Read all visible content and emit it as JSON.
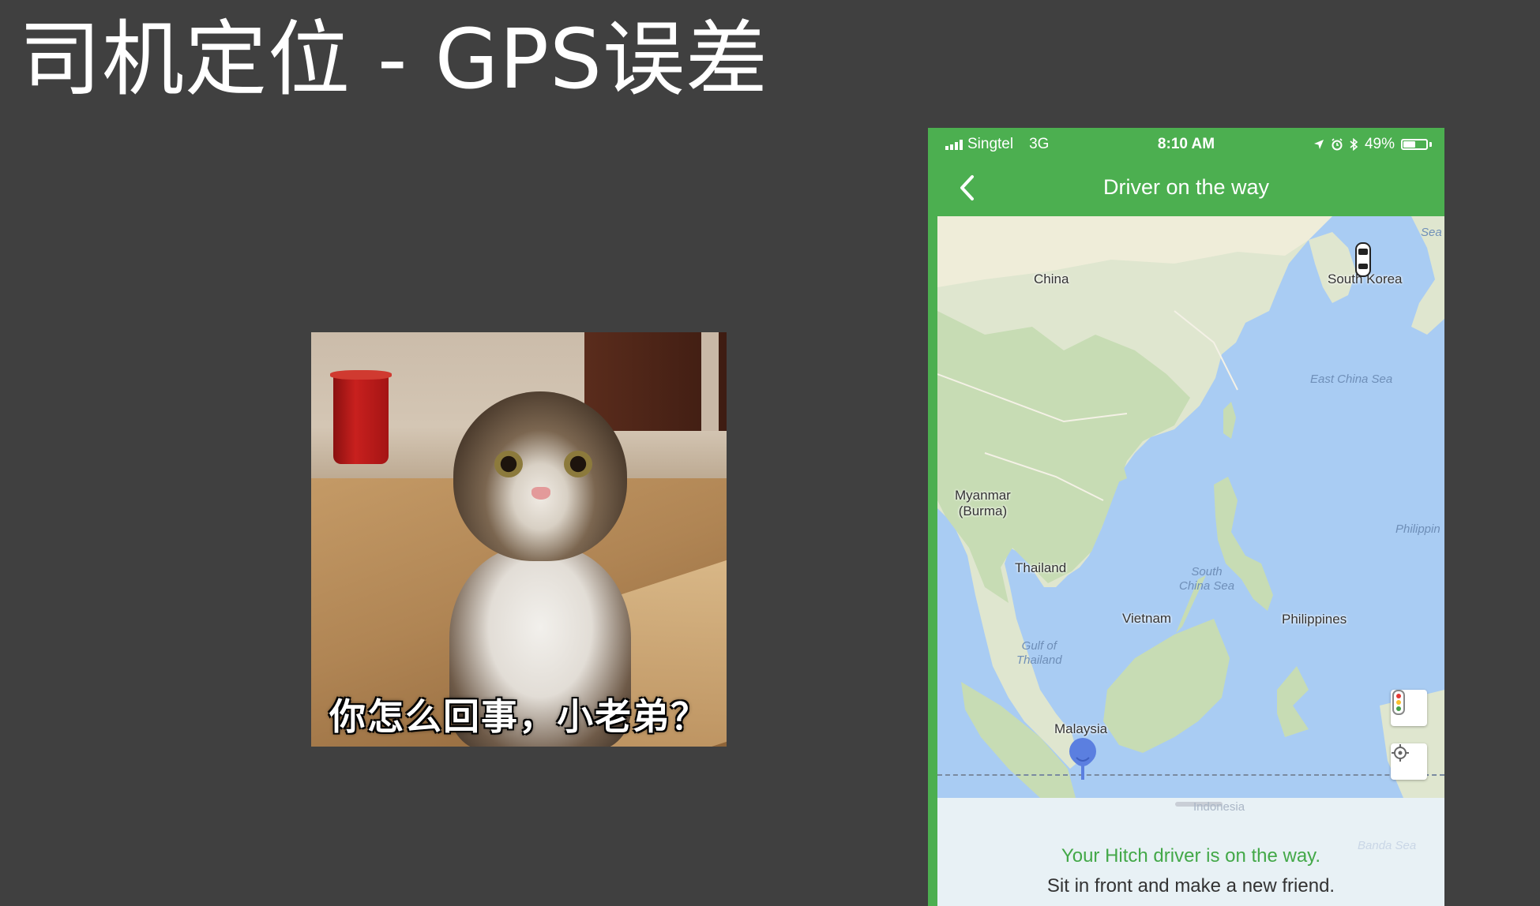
{
  "slide": {
    "title": "司机定位 - GPS误差"
  },
  "meme": {
    "caption": "你怎么回事，小老弟？"
  },
  "phone": {
    "status_bar": {
      "carrier": "Singtel",
      "network": "3G",
      "time": "8:10 AM",
      "battery": "49%",
      "battery_level": 0.49
    },
    "nav": {
      "title": "Driver on the way",
      "back_icon": "chevron-left-icon"
    },
    "map": {
      "labels": {
        "china": "China",
        "south_korea": "South Korea",
        "east_china_sea": "East China Sea",
        "sea_top": "Sea",
        "myanmar": "Myanmar\n(Burma)",
        "thailand": "Thailand",
        "south_china_sea": "South\nChina Sea",
        "philippine_sea": "Philippin",
        "vietnam": "Vietnam",
        "philippines": "Philippines",
        "gulf_of_thailand": "Gulf of\nThailand",
        "malaysia": "Malaysia",
        "indonesia": "Indonesia",
        "banda_sea": "Banda Sea"
      },
      "buttons": {
        "traffic_icon": "traffic-light-icon",
        "locate_icon": "crosshair-icon"
      },
      "markers": {
        "car_icon": "car-icon",
        "pin_icon": "location-pin-icon"
      }
    },
    "panel": {
      "status": "Your Hitch driver is on the way.",
      "hint": "Sit in front and make a new friend."
    },
    "colors": {
      "brand_green": "#4caf50",
      "status_text_green": "#43a848",
      "map_water": "#a9ccf3",
      "map_land": "#e6e6d4",
      "pin_blue": "#5b7fe0"
    }
  }
}
